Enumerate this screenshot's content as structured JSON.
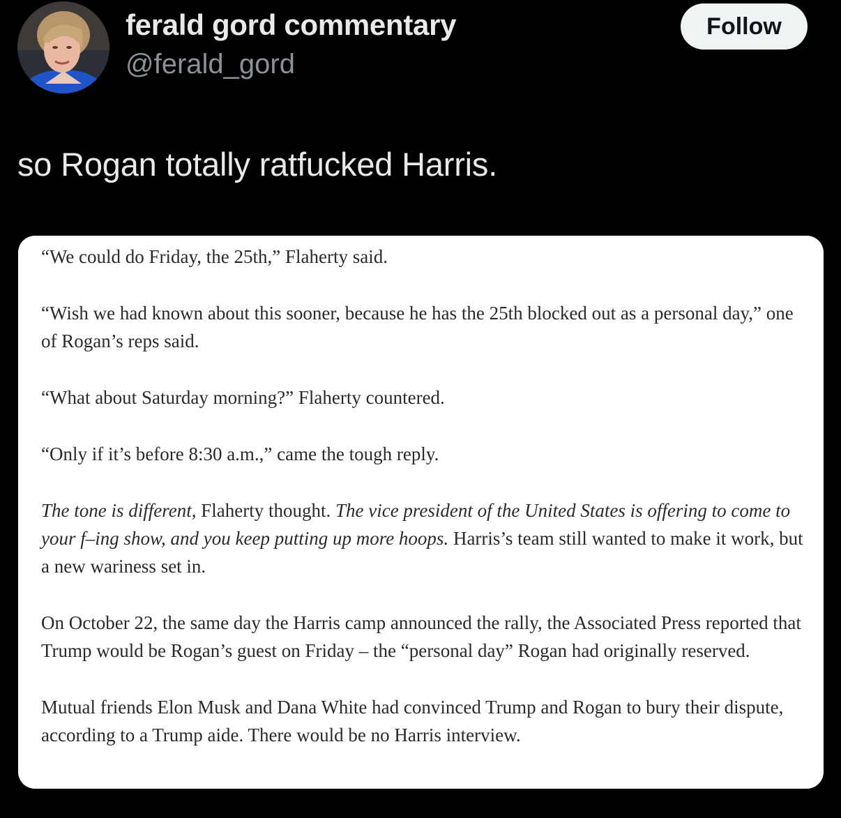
{
  "author": {
    "display_name": "ferald gord commentary",
    "handle": "@ferald_gord",
    "avatar_icon": "profile-photo"
  },
  "follow_button": {
    "label": "Follow"
  },
  "tweet": {
    "text": "so Rogan totally ratfucked Harris."
  },
  "article_screenshot": {
    "paragraphs": [
      {
        "segments": [
          {
            "text": "“We could do Friday, the 25th,” Flaherty said.",
            "italic": false
          }
        ]
      },
      {
        "segments": [
          {
            "text": "“Wish we had known about this sooner, because he has the 25th blocked out as a personal day,” one of Rogan’s reps said.",
            "italic": false
          }
        ]
      },
      {
        "segments": [
          {
            "text": "“What about Saturday morning?” Flaherty countered.",
            "italic": false
          }
        ]
      },
      {
        "segments": [
          {
            "text": "“Only if it’s before 8:30 a.m.,” came the tough reply.",
            "italic": false
          }
        ]
      },
      {
        "segments": [
          {
            "text": "The tone is different,",
            "italic": true
          },
          {
            "text": " Flaherty thought. ",
            "italic": false
          },
          {
            "text": "The vice president of the United States is offering to come to your f–ing show, and you keep putting up more hoops.",
            "italic": true
          },
          {
            "text": " Harris’s team still wanted to make it work, but a new wariness set in.",
            "italic": false
          }
        ]
      },
      {
        "segments": [
          {
            "text": "On October 22, the same day the Harris camp announced the rally, the Associated Press reported that Trump would be Rogan’s guest on Friday – the “personal day” Rogan had originally reserved.",
            "italic": false
          }
        ]
      },
      {
        "segments": [
          {
            "text": "Mutual friends Elon Musk and Dana White had convinced Trump and Rogan to bury their dispute, according to a Trump aide. There would be no Harris interview.",
            "italic": false
          }
        ]
      }
    ]
  }
}
